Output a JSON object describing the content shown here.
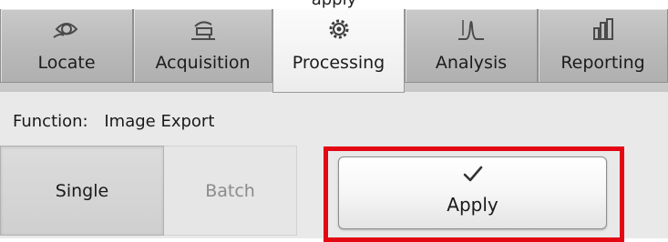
{
  "caption": {
    "text": "apply"
  },
  "tabs": [
    {
      "label": "Locate",
      "icon": "eye-icon"
    },
    {
      "label": "Acquisition",
      "icon": "microscope-icon"
    },
    {
      "label": "Processing",
      "icon": "gear-icon",
      "active": true
    },
    {
      "label": "Analysis",
      "icon": "peak-icon"
    },
    {
      "label": "Reporting",
      "icon": "bar-chart-icon"
    }
  ],
  "function": {
    "label": "Function:",
    "value": "Image Export"
  },
  "mode": {
    "single_label": "Single",
    "batch_label": "Batch",
    "selected": "Single"
  },
  "apply": {
    "label": "Apply",
    "icon": "checkmark-icon"
  },
  "colors": {
    "highlight": "#e30613",
    "active_tab": "#f4f4f4",
    "tab": "#bcbcbc"
  }
}
